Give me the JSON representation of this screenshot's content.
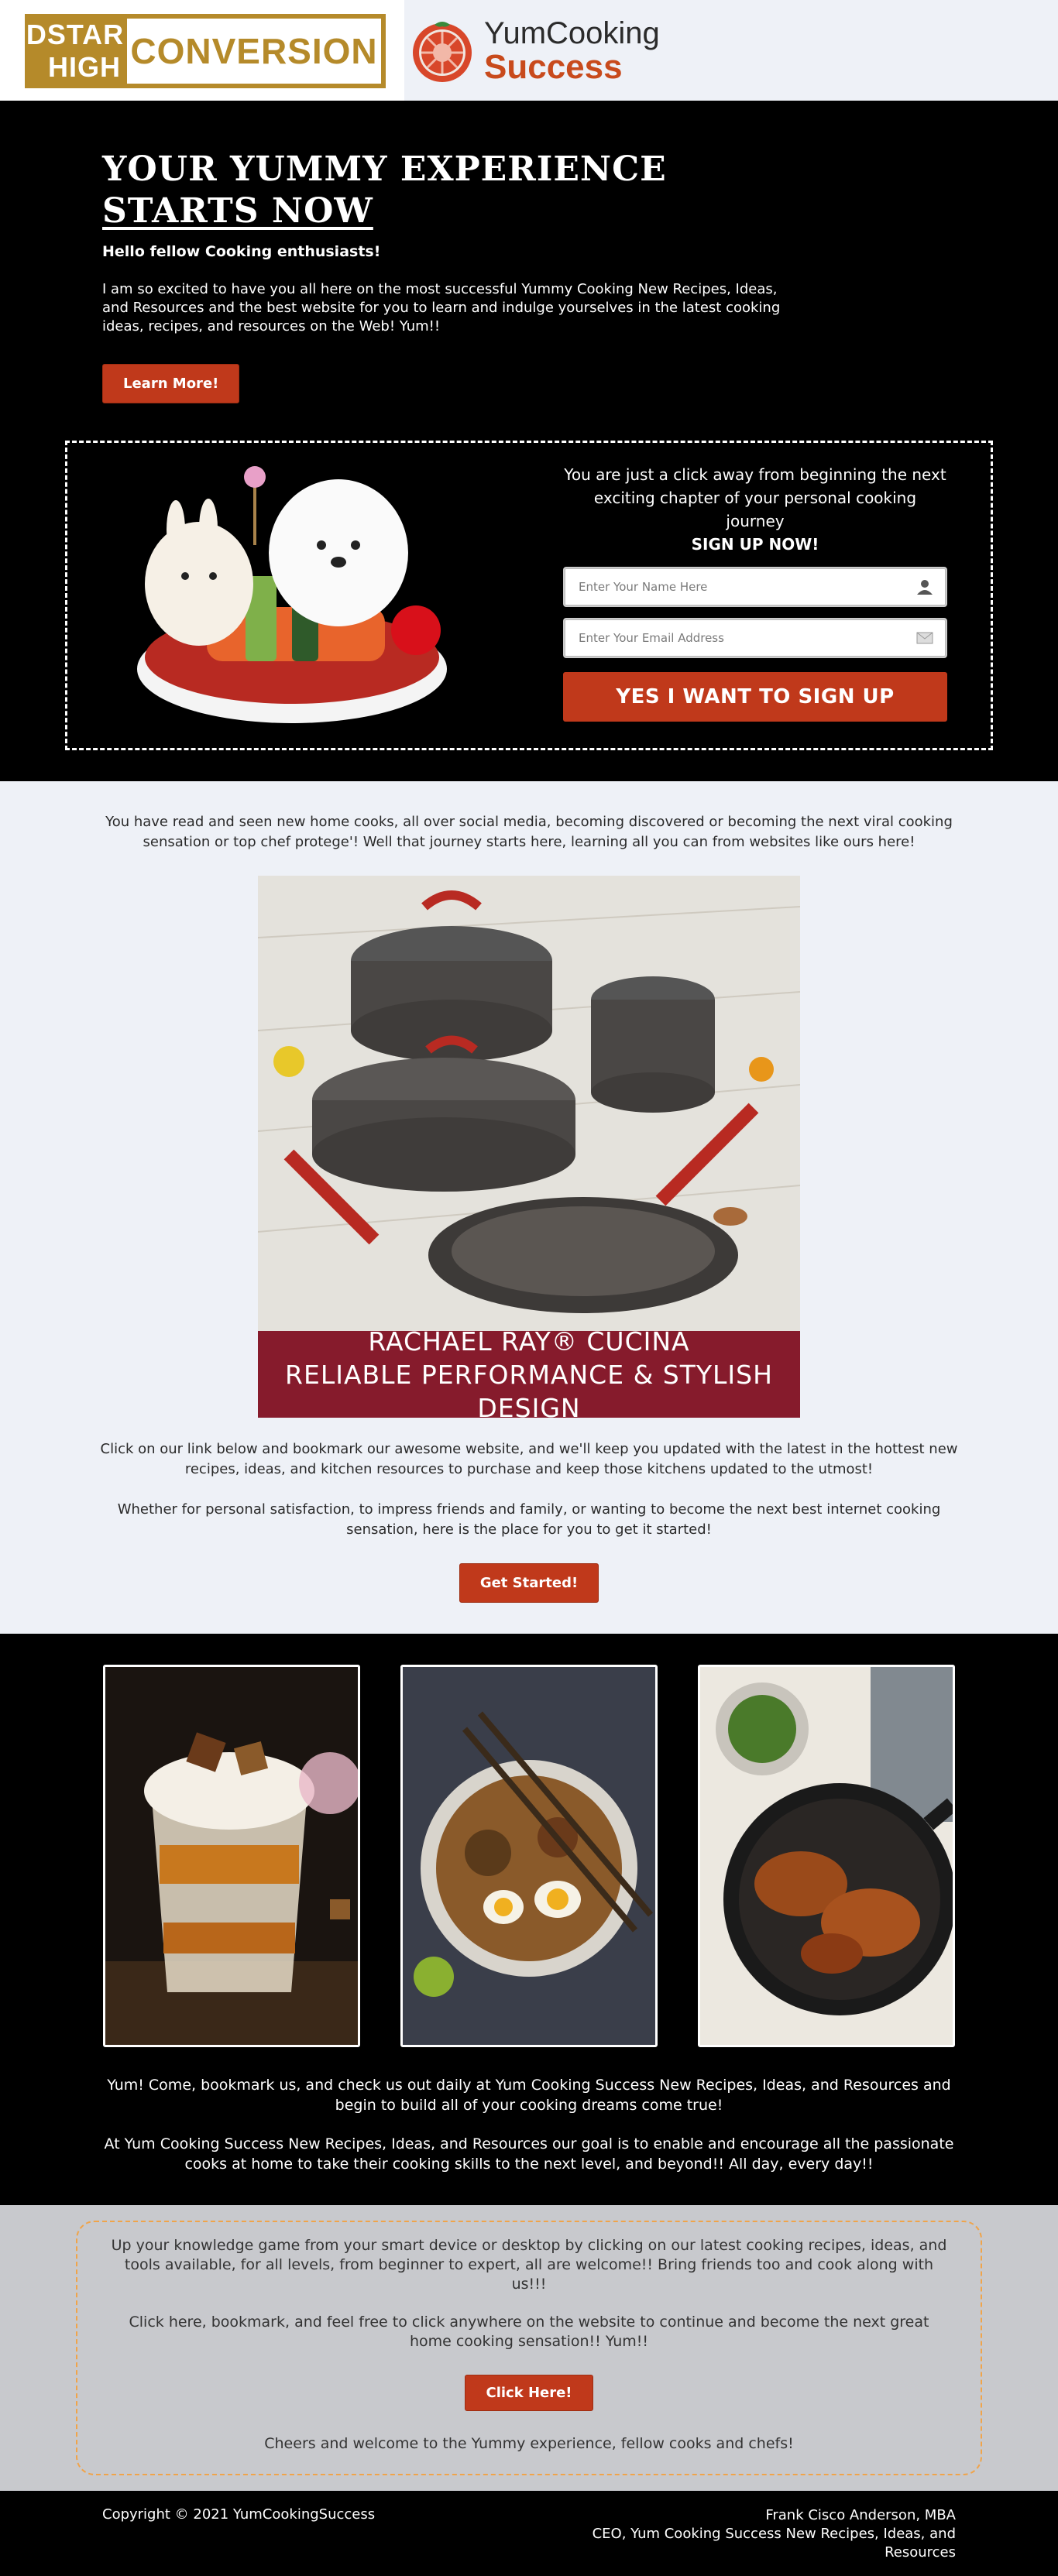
{
  "header": {
    "dstar_logo": {
      "line1": "DSTAR",
      "line2": "HIGH",
      "word": "CONVERSION"
    },
    "brand": {
      "line1": "YumCooking",
      "line2": "Success"
    }
  },
  "hero": {
    "title_line1": "YOUR YUMMY EXPERIENCE",
    "title_line2": "STARTS NOW",
    "greeting": "Hello fellow Cooking enthusiasts!",
    "body": "I am so excited to have you all here on the most successful Yummy Cooking New Recipes, Ideas, and Resources and the best website for you to learn and indulge yourselves in the latest cooking ideas, recipes, and resources on the Web! Yum!!",
    "cta": "Learn More!"
  },
  "signup": {
    "message": "You are just a click away from beginning the next exciting chapter of your personal cooking journey",
    "emphasis": "SIGN UP NOW!",
    "name_placeholder": "Enter Your Name Here",
    "email_placeholder": "Enter Your Email Address",
    "submit": "YES I WANT TO SIGN UP"
  },
  "intro": {
    "text": "You have read and seen new home cooks, all over social media, becoming discovered or becoming the next viral cooking sensation or top chef protege'! Well that journey starts here, learning all you can from websites like ours here!",
    "banner_line1": "RACHAEL RAY® CUCINA",
    "banner_line2": "RELIABLE PERFORMANCE & STYLISH DESIGN",
    "para2": "Click on our link below and bookmark our awesome website, and we'll keep you updated with the latest in the hottest new recipes, ideas, and kitchen resources to purchase and keep those kitchens updated to the utmost!",
    "para3": "Whether for personal satisfaction, to impress friends and family, or wanting to become the next best internet cooking sensation, here is the place for you to get it started!",
    "cta": "Get Started!"
  },
  "gallery": {
    "para1": "Yum! Come, bookmark us, and check us out daily at Yum Cooking Success New Recipes, Ideas, and Resources and begin to build all of your cooking dreams come true!",
    "para2": "At Yum Cooking Success New Recipes, Ideas, and Resources our goal is to enable and encourage all the passionate cooks at home to take their cooking skills to the next level, and beyond!! All day, every day!!"
  },
  "bottom": {
    "para1": "Up your knowledge game from your smart device or desktop by clicking on our latest cooking recipes, ideas, and tools available, for all levels, from beginner to expert, all are welcome!! Bring friends too and cook along with us!!!",
    "para2": "Click here, bookmark, and feel free to click anywhere on the website to continue and become the next great home cooking sensation!! Yum!!",
    "cta": "Click Here!",
    "closing": "Cheers and welcome to the Yummy experience, fellow cooks and chefs!"
  },
  "footer": {
    "copyright": "Copyright © 2021 YumCookingSuccess",
    "name": "Frank Cisco Anderson, MBA",
    "title": "CEO, Yum Cooking Success New Recipes, Ideas, and Resources"
  },
  "colors": {
    "accent": "#c0391b",
    "banner": "#861b2c",
    "gold": "#b58a2a",
    "light_bg": "#eef1f7",
    "grey_bg": "#c8c9cd"
  },
  "icons": [
    "user-icon",
    "mail-icon",
    "tomato-logo-icon"
  ]
}
